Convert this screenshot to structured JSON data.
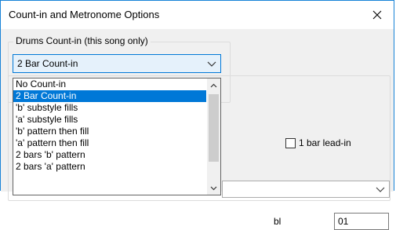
{
  "window": {
    "title": "Count-in and Metronome Options"
  },
  "drums": {
    "group_label": "Drums Count-in (this song only)",
    "selected": "2 Bar Count-in",
    "options": [
      "No Count-in",
      "2 Bar Count-in",
      "'b' substyle fills",
      "'a' substyle fills",
      "'b' pattern then fill",
      "'a' pattern then fill",
      "2 bars 'b' pattern",
      "2 bars 'a' pattern"
    ],
    "highlighted_index": 1
  },
  "lead_in": {
    "label": "1 bar lead-in",
    "checked": false
  },
  "partial": {
    "label_fragment": "bl",
    "field_value": "01"
  },
  "colors": {
    "accent": "#0078d7",
    "combo_bg": "#e5f1fb"
  }
}
